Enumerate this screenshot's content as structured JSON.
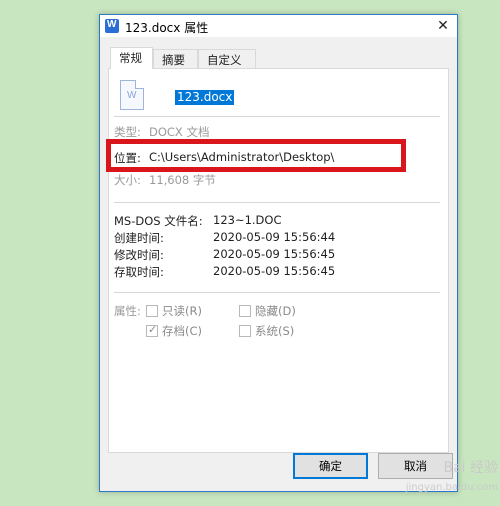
{
  "window": {
    "title": "123.docx 属性",
    "close_glyph": "✕"
  },
  "tabs": [
    {
      "label": "常规",
      "active": true
    },
    {
      "label": "摘要",
      "active": false
    },
    {
      "label": "自定义",
      "active": false
    }
  ],
  "file": {
    "icon": "word-document-icon",
    "name": "123.docx"
  },
  "details": {
    "type_label": "类型:",
    "type_value": "DOCX 文档",
    "location_label": "位置:",
    "location_value": "C:\\Users\\Administrator\\Desktop\\",
    "size_label": "大小:",
    "size_value": "11,608 字节"
  },
  "dates": [
    {
      "label": "MS-DOS 文件名:",
      "value": "123~1.DOC"
    },
    {
      "label": "创建时间:",
      "value": "2020-05-09 15:56:44"
    },
    {
      "label": "修改时间:",
      "value": "2020-05-09 15:56:45"
    },
    {
      "label": "存取时间:",
      "value": "2020-05-09 15:56:45"
    }
  ],
  "attributes": {
    "label": "属性:",
    "readonly": {
      "label": "只读(R)",
      "checked": false
    },
    "hidden": {
      "label": "隐藏(D)",
      "checked": false
    },
    "archive": {
      "label": "存档(C)",
      "checked": true
    },
    "system": {
      "label": "系统(S)",
      "checked": false
    }
  },
  "buttons": {
    "ok": "确定",
    "cancel": "取消"
  },
  "annotation_color": "#d8161b",
  "watermark": {
    "line1": "Bai 经验",
    "line2": "jingyan.baidu.com"
  }
}
